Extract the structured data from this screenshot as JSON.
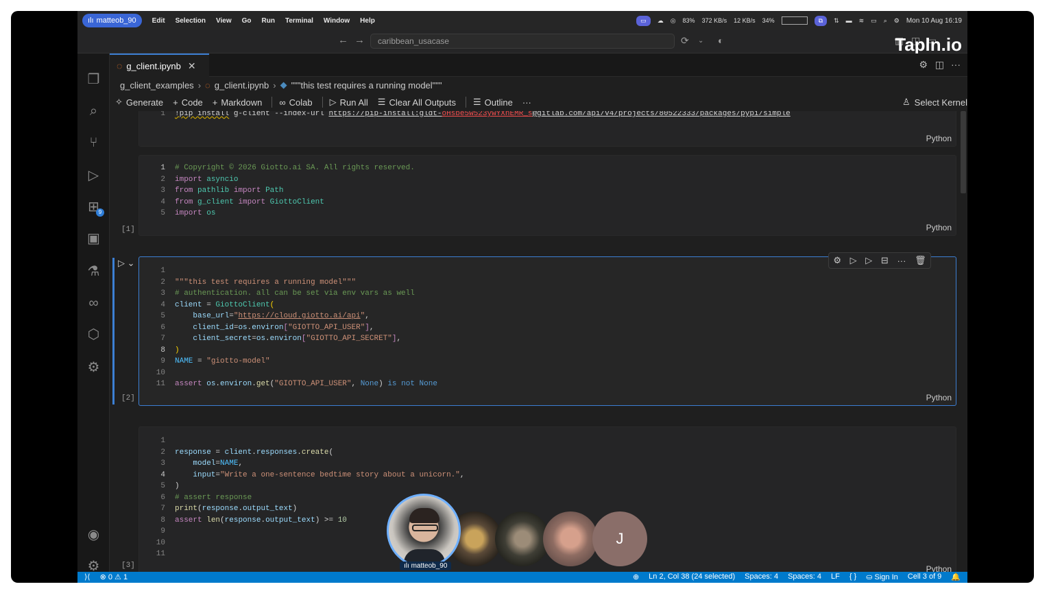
{
  "menubar": {
    "user_pill": "matteob_90",
    "menus": [
      "Edit",
      "Selection",
      "View",
      "Go",
      "Run",
      "Terminal",
      "Window",
      "Help"
    ],
    "status": {
      "ram": "83%",
      "net_up": "372 KB/s",
      "net_down": "12 KB/s",
      "gpu": "34%",
      "datetime": "Mon 10 Aug  16:19"
    }
  },
  "titlebar": {
    "search_placeholder": "caribbean_usacase",
    "watermark": "Tapln.io"
  },
  "activity": {
    "extensions_badge": "9"
  },
  "tab": {
    "filename": "g_client.ipynb"
  },
  "breadcrumb": {
    "folder": "g_client_examples",
    "file": "g_client.ipynb",
    "cell": "\"\"\"this test requires a running model\"\"\""
  },
  "toolbar": {
    "generate": "Generate",
    "code": "Code",
    "markdown": "Markdown",
    "colab": "Colab",
    "run_all": "Run All",
    "clear_all": "Clear All Outputs",
    "outline": "Outline",
    "more": "···",
    "select_kernel": "Select Kernel"
  },
  "cells": [
    {
      "exec": "",
      "lang": "Python"
    },
    {
      "exec": "[1]",
      "lang": "Python"
    },
    {
      "exec": "[2]",
      "lang": "Python"
    },
    {
      "exec": "[3]",
      "lang": "Python"
    }
  ],
  "statusbar": {
    "errors": "0",
    "warnings": "1",
    "position": "Ln 2, Col 38 (24 selected)",
    "spaces1": "Spaces: 4",
    "spaces2": "Spaces: 4",
    "eol": "LF",
    "braces": "{ }",
    "signin": "Sign In",
    "cell": "Cell 3 of 9"
  },
  "participants": {
    "main_label": "matteob_90",
    "initial": "J"
  }
}
